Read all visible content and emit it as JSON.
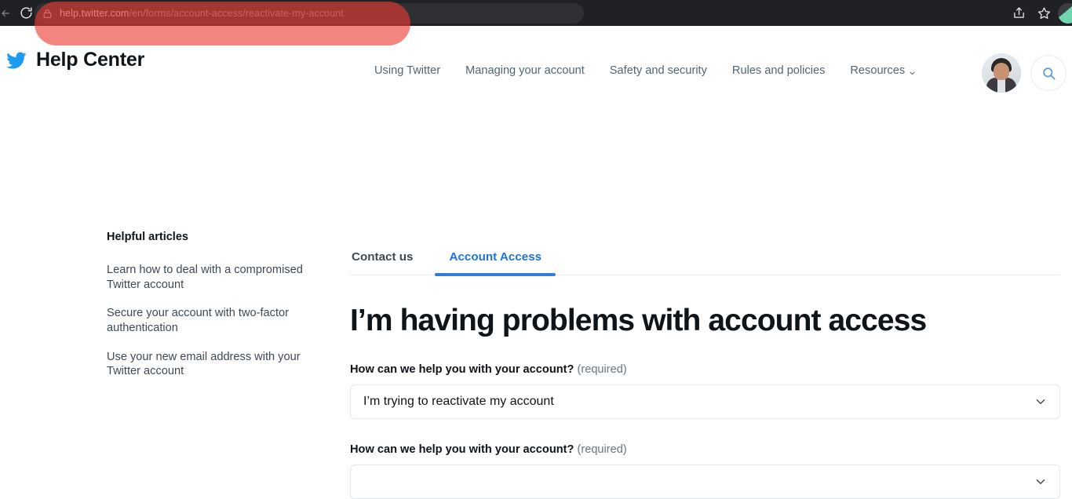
{
  "browser": {
    "url_host": "help.twitter.com",
    "url_path": "/en/forms/account-access/reactivate-my-account",
    "reload_icon": "reload-icon",
    "lock_icon": "lock-icon",
    "share_icon": "share-icon",
    "bookmark_icon": "star-icon",
    "bar_color": "#202124",
    "highlight_color": "#eb3a34"
  },
  "header": {
    "logo_icon": "twitter-bird-icon",
    "title": "Help Center",
    "nav": [
      {
        "label": "Using Twitter",
        "has_chevron": false
      },
      {
        "label": "Managing your account",
        "has_chevron": false
      },
      {
        "label": "Safety and security",
        "has_chevron": false
      },
      {
        "label": "Rules and policies",
        "has_chevron": false
      },
      {
        "label": "Resources",
        "has_chevron": true
      }
    ],
    "avatar_name": "user-avatar",
    "search_icon": "search-icon",
    "brand_color": "#1d9bf0"
  },
  "sidebar": {
    "title": "Helpful articles",
    "articles": [
      "Learn how to deal with a compromised Twitter account",
      "Secure your account with two-factor authentication",
      "Use your new email address with your Twitter account"
    ]
  },
  "main": {
    "tabs": [
      {
        "label": "Contact us",
        "active": false
      },
      {
        "label": "Account Access",
        "active": true
      }
    ],
    "heading": "I’m having problems with account access",
    "active_tab_color": "#2f7ed8",
    "fields": [
      {
        "label": "How can we help you with your account?",
        "required_text": "(required)",
        "value": "I’m trying to reactivate my account",
        "chevron_icon": "chevron-down-icon"
      },
      {
        "label": "How can we help you with your account?",
        "required_text": "(required)",
        "value": "",
        "chevron_icon": "chevron-down-icon"
      }
    ]
  }
}
